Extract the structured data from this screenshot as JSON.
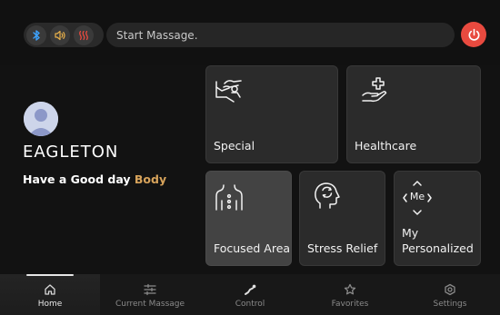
{
  "topbar": {
    "status_icons": [
      "bluetooth-icon",
      "sound-icon",
      "heat-icon"
    ],
    "search_placeholder": "Start Massage.",
    "power_icon": "power-icon",
    "colors": {
      "bluetooth": "#3da3ff",
      "sound": "#e8b04a",
      "heat": "#e84a3f",
      "power": "#e84a3f"
    }
  },
  "profile": {
    "avatar_icon": "avatar-icon",
    "name": "EAGLETON",
    "greeting": "Have a Good day",
    "greeting_accent": "Body",
    "accent_color": "#d7a35b"
  },
  "cards": {
    "special": {
      "label": "Special",
      "icon": "massage-chair-icon"
    },
    "healthcare": {
      "label": "Healthcare",
      "icon": "healthcare-hand-icon"
    },
    "focused": {
      "label": "Focused Area",
      "icon": "body-spine-icon"
    },
    "stress": {
      "label": "Stress Relief",
      "icon": "head-relief-icon"
    },
    "personal": {
      "label_line1": "My",
      "label_line2": "Personalized",
      "icon_text": "Me",
      "icon": "me-direction-icon"
    }
  },
  "nav": {
    "items": [
      {
        "label": "Home",
        "icon": "home-icon",
        "active": true
      },
      {
        "label": "Current Massage",
        "icon": "sliders-icon",
        "active": false
      },
      {
        "label": "Control",
        "icon": "control-icon",
        "active": false
      },
      {
        "label": "Favorites",
        "icon": "star-icon",
        "active": false
      },
      {
        "label": "Settings",
        "icon": "gear-icon",
        "active": false
      }
    ]
  }
}
